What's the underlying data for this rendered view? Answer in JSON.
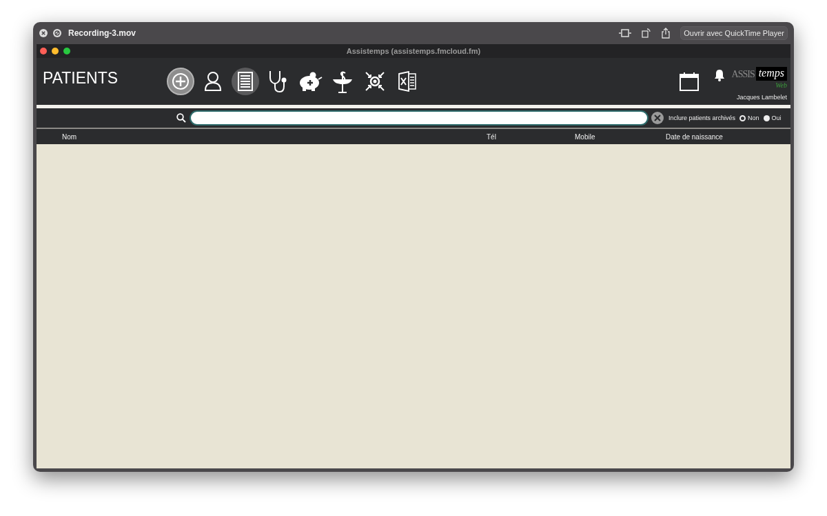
{
  "player": {
    "title": "Recording-3.mov",
    "open_button": "Ouvrir avec QuickTime Player"
  },
  "window": {
    "title": "Assistemps (assistemps.fmcloud.fm)"
  },
  "header": {
    "title": "PATIENTS",
    "user": "Jacques Lambelet",
    "logo": {
      "part_1": "ASSIS",
      "part_2": "temps",
      "part_3": "Web"
    }
  },
  "toolbar": [
    {
      "kind": "add",
      "selected": false,
      "hovered": true
    },
    {
      "kind": "person",
      "selected": false,
      "hovered": false
    },
    {
      "kind": "list",
      "selected": true,
      "hovered": false
    },
    {
      "kind": "stethoscope",
      "selected": false,
      "hovered": false
    },
    {
      "kind": "piggy",
      "selected": false,
      "hovered": false
    },
    {
      "kind": "caduceus",
      "selected": false,
      "hovered": false
    },
    {
      "kind": "merge",
      "selected": false,
      "hovered": false
    },
    {
      "kind": "excel",
      "selected": false,
      "hovered": false
    }
  ],
  "archived": {
    "label": "Inclure patients archivés",
    "options": [
      {
        "label": "Non",
        "selected": true
      },
      {
        "label": "Oui",
        "selected": false
      }
    ]
  },
  "table": {
    "columns": [
      {
        "label": "Nom"
      },
      {
        "label": "Tél"
      },
      {
        "label": "Mobile"
      },
      {
        "label": "Date de naissance"
      }
    ]
  }
}
